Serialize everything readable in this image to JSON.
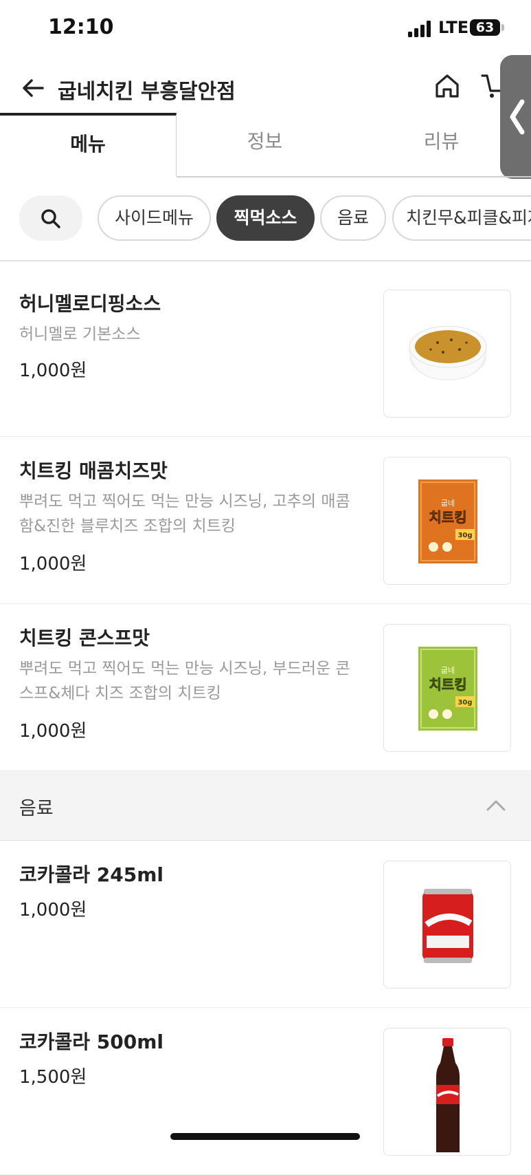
{
  "status": {
    "time": "12:10",
    "network": "LTE",
    "battery": "63"
  },
  "header": {
    "title": "굽네치킨 부흥달안점",
    "icons": [
      "back-arrow-icon",
      "home-icon",
      "cart-icon"
    ]
  },
  "tabs": [
    {
      "label": "메뉴",
      "active": true
    },
    {
      "label": "정보",
      "active": false
    },
    {
      "label": "리뷰",
      "active": false
    }
  ],
  "chips": [
    {
      "label": "사이드메뉴",
      "active": false
    },
    {
      "label": "찍먹소스",
      "active": true
    },
    {
      "label": "음료",
      "active": false
    },
    {
      "label": "치킨무&피클&피자",
      "active": false
    }
  ],
  "items": [
    {
      "name": "허니멜로디핑소스",
      "desc": "허니멜로 기본소스",
      "price": "1,000원",
      "image": "sauce-bowl"
    },
    {
      "name": "치트킹 매콤치즈맛",
      "desc": "뿌려도 먹고 찍어도 먹는 만능 시즈닝, 고추의 매콤함&진한 블루치즈 조합의 치트킹",
      "price": "1,000원",
      "image": "seasoning-orange",
      "pack_brand": "굽네",
      "pack_name": "치트킹",
      "pack_weight": "30g"
    },
    {
      "name": "치트킹 콘스프맛",
      "desc": "뿌려도 먹고 찍어도 먹는 만능 시즈닝, 부드러운 콘스프&체다 치즈 조합의 치트킹",
      "price": "1,000원",
      "image": "seasoning-green",
      "pack_brand": "굽네",
      "pack_name": "치트킹",
      "pack_weight": "30g"
    }
  ],
  "section": {
    "label": "음료",
    "expanded": true
  },
  "drinks": [
    {
      "name": "코카콜라 245ml",
      "price": "1,000원",
      "image": "coke-can"
    },
    {
      "name": "코카콜라 500ml",
      "price": "1,500원",
      "image": "coke-bottle"
    }
  ],
  "colors": {
    "accent": "#222222",
    "active_chip": "#3f3f3f",
    "muted": "#9a9a9a",
    "section_bg": "#f4f4f4"
  }
}
